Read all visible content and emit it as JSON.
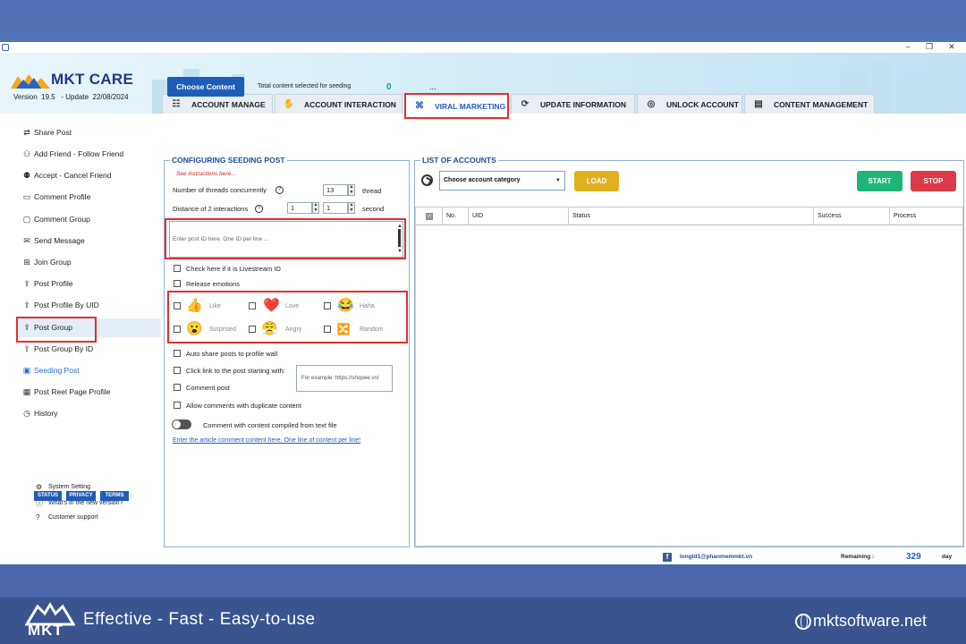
{
  "app": {
    "name": "MKT CARE",
    "version_label": "Version",
    "version": "19.5",
    "update_label": "- Update",
    "update_date": "22/08/2024"
  },
  "tabs": [
    {
      "label": "ACCOUNT MANAGE",
      "icon": "list-icon"
    },
    {
      "label": "ACCOUNT INTERACTION",
      "icon": "hand-icon"
    },
    {
      "label": "VIRAL MARKETING",
      "icon": "network-icon",
      "active": true
    },
    {
      "label": "UPDATE INFORMATION",
      "icon": "refresh-user-icon"
    },
    {
      "label": "UNLOCK ACCOUNT",
      "icon": "fingerprint-icon"
    },
    {
      "label": "CONTENT MANAGEMENT",
      "icon": "document-icon"
    }
  ],
  "sidebar": {
    "items": [
      {
        "label": "Share Post",
        "icon": "share-icon"
      },
      {
        "label": "Add Friend - Follow Friend",
        "icon": "add-friend-icon"
      },
      {
        "label": "Accept - Cancel Friend",
        "icon": "accept-friend-icon"
      },
      {
        "label": "Comment Profile",
        "icon": "comment-icon"
      },
      {
        "label": "Comment Group",
        "icon": "comment-group-icon"
      },
      {
        "label": "Send Message",
        "icon": "message-icon"
      },
      {
        "label": "Join Group",
        "icon": "join-group-icon"
      },
      {
        "label": "Post Profile",
        "icon": "upload-icon"
      },
      {
        "label": "Post Profile By UID",
        "icon": "upload-icon"
      },
      {
        "label": "Post Group",
        "icon": "upload-icon"
      },
      {
        "label": "Post Group By ID",
        "icon": "upload-icon"
      },
      {
        "label": "Seeding Post",
        "icon": "seeding-icon",
        "active": true
      },
      {
        "label": "Post Reel Page Profile",
        "icon": "reel-icon"
      },
      {
        "label": "History",
        "icon": "history-icon"
      }
    ],
    "footer_links": [
      {
        "label": "System Setting",
        "icon": "gear-icon"
      },
      {
        "label": "What's in the new version?",
        "icon": "info-icon"
      },
      {
        "label": "Customer support",
        "icon": "question-icon"
      }
    ],
    "badges": [
      "STATUS",
      "PRIVACY",
      "TERMS"
    ]
  },
  "content": {
    "choose_button": "Choose Content",
    "total_label": "Total content selected for seeding",
    "total_value": "0",
    "total_extra": "..."
  },
  "config": {
    "title": "CONFIGURING SEEDING POST",
    "instructions": "See instructions here...",
    "threads_label": "Number of threads concurrently",
    "threads_value": "13",
    "threads_unit": "thread",
    "distance_label": "Distance of 2 interactions",
    "distance_from": "1",
    "distance_to": "1",
    "distance_unit": "second",
    "post_id_placeholder": "Enter post ID here. One ID per line ...",
    "livestream_label": "Check here if it is Livestream ID",
    "release_emotions_label": "Release emotions",
    "emotions": [
      {
        "label": "Like",
        "glyph": "👍"
      },
      {
        "label": "Love",
        "glyph": "❤️"
      },
      {
        "label": "Haha",
        "glyph": "😂"
      },
      {
        "label": "Surprised",
        "glyph": "😮"
      },
      {
        "label": "Angry",
        "glyph": "😤"
      },
      {
        "label": "Random",
        "glyph": "🔀"
      }
    ],
    "auto_share_label": "Auto share posts to profile wall",
    "click_link_label": "Click link to the post starting with:",
    "example_placeholder": "For example: https://shopee.vn/",
    "comment_post_label": "Comment post",
    "allow_duplicate_label": "Allow comments with duplicate content",
    "comment_file_label": "Comment with content compiled from text file",
    "comment_link": "Enter the article comment content here.  One line of content per line!"
  },
  "accounts": {
    "title": "LIST OF ACCOUNTS",
    "category_select": "Choose account category",
    "load_button": "LOAD",
    "start_button": "START",
    "stop_button": "STOP",
    "columns": [
      "No.",
      "UID",
      "Status",
      "Success",
      "Process"
    ]
  },
  "status_bar": {
    "email": "longld1@phanmemmkt.vn",
    "remaining_label": "Remaining :",
    "remaining_value": "329",
    "remaining_unit": "day"
  },
  "footer": {
    "brand": "MKT",
    "slogan": "Effective - Fast - Easy-to-use",
    "website": "mktsoftware.net"
  },
  "colors": {
    "accent": "#1f5cb7",
    "highlight": "#e03030",
    "start": "#1fb57a",
    "stop": "#dc3a48",
    "load": "#e0b020"
  }
}
